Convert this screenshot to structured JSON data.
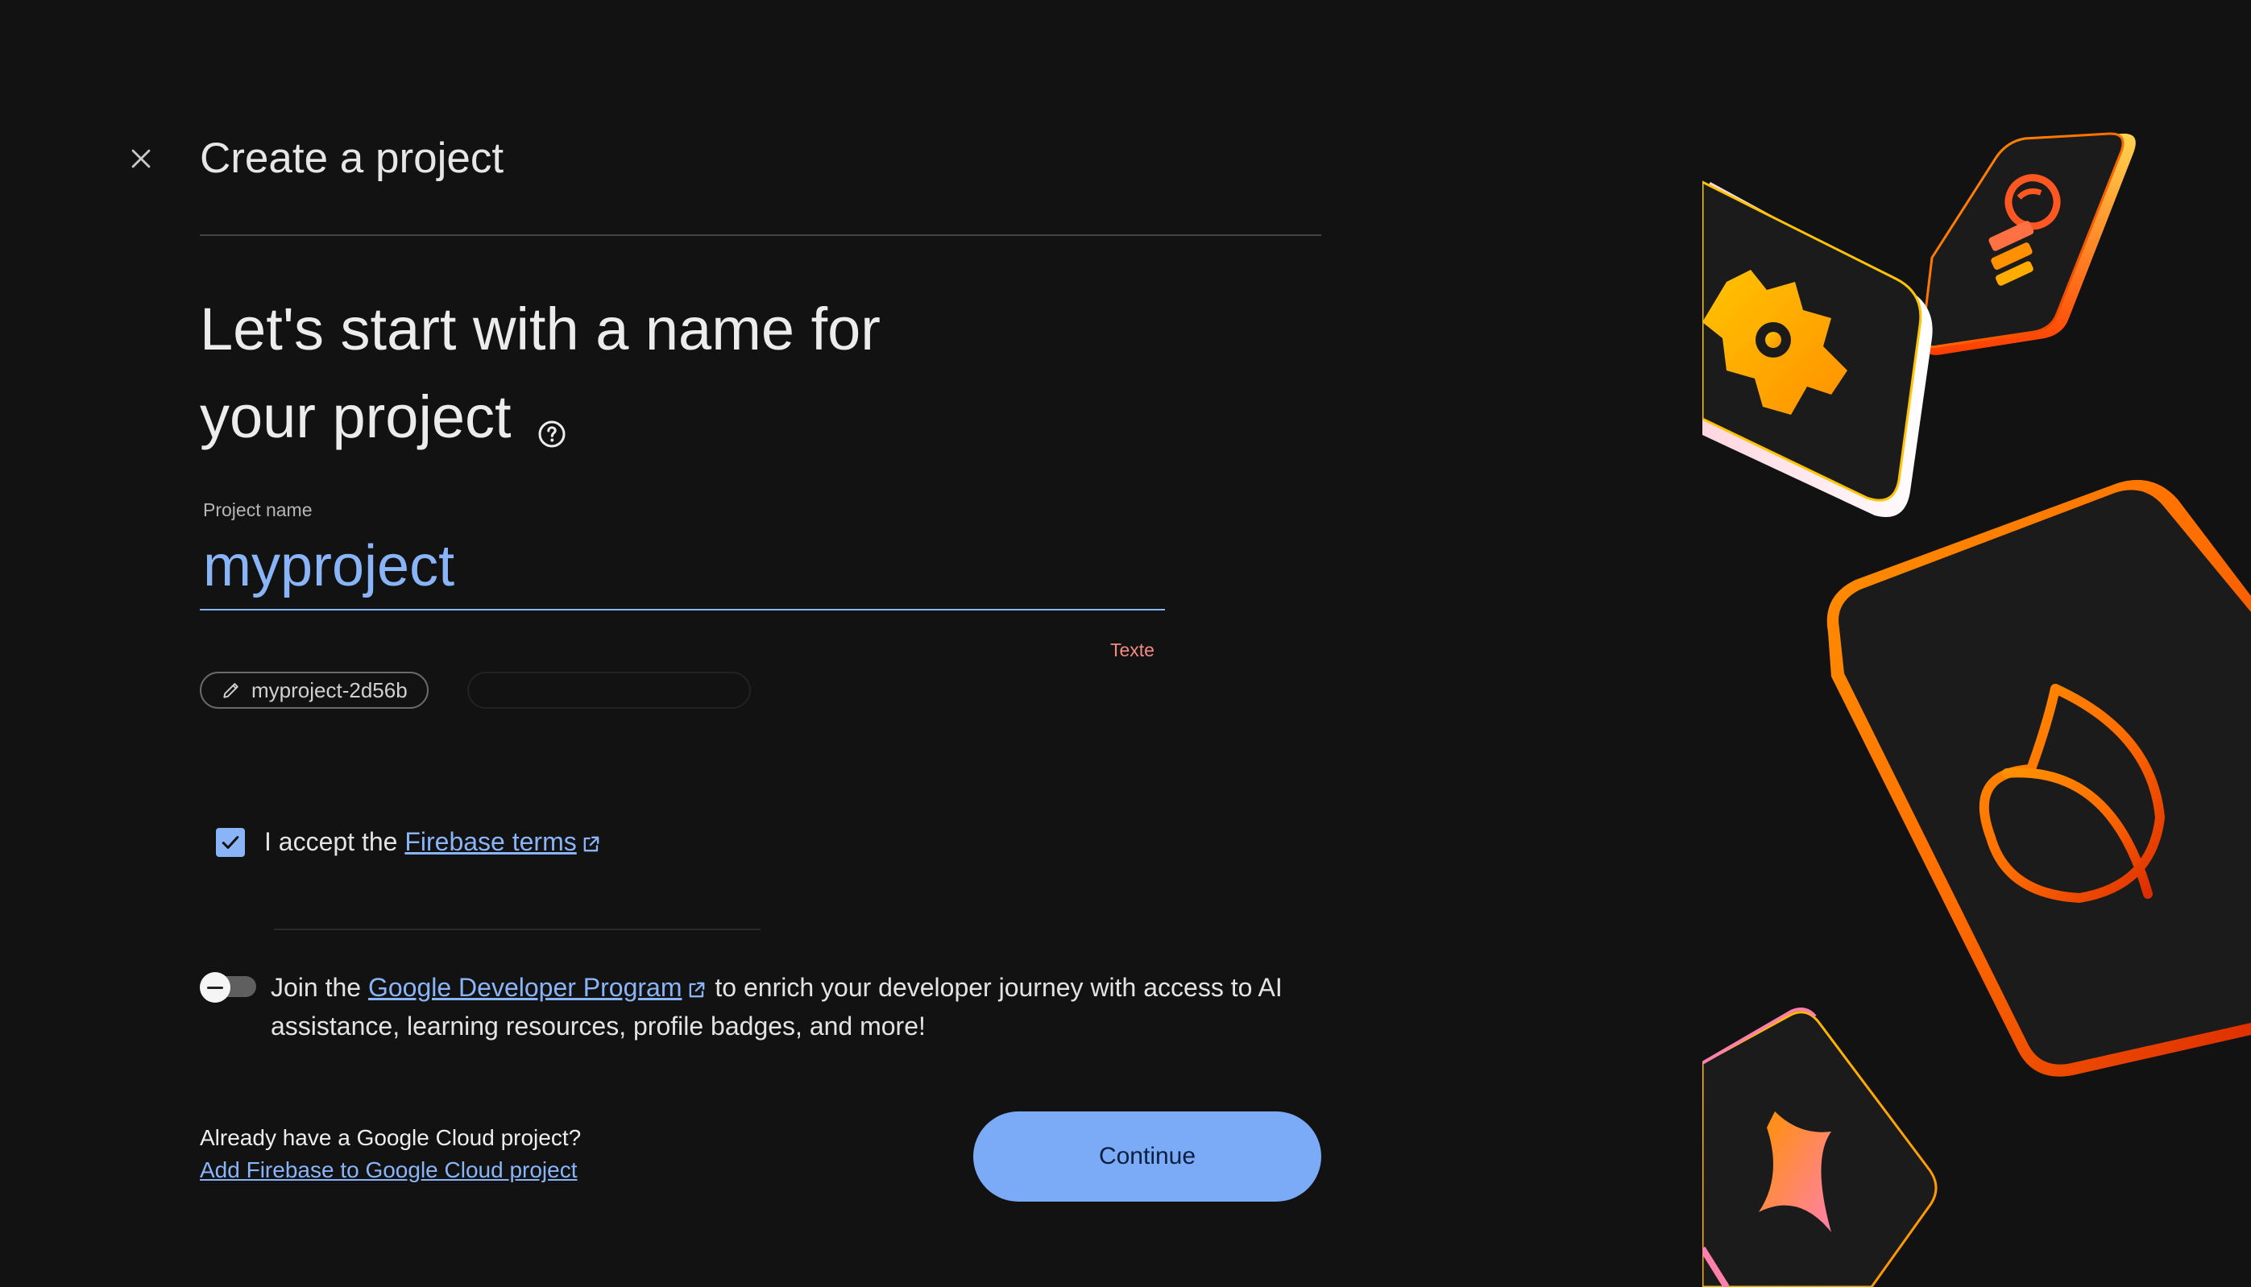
{
  "header": {
    "title": "Create a project"
  },
  "headline": {
    "line1": "Let's start with a name for",
    "line2": "your project"
  },
  "project_name": {
    "label": "Project name",
    "value": "myproject",
    "error": "Texte"
  },
  "project_id_chip": {
    "label": "myproject-2d56b"
  },
  "terms": {
    "prefix": "I accept the ",
    "link": "Firebase terms",
    "checked": true
  },
  "gdp": {
    "prefix": "Join the ",
    "link": "Google Developer Program",
    "suffix": " to enrich your developer journey with access to AI assistance, learning resources, profile badges, and more!",
    "enabled": false
  },
  "cloud": {
    "question": "Already have a Google Cloud project?",
    "link": "Add Firebase to Google Cloud project"
  },
  "actions": {
    "continue_label": "Continue"
  },
  "colors": {
    "background": "#121212",
    "accent": "#8ab4f8",
    "button": "#7baaf7",
    "error": "#f28b82"
  }
}
